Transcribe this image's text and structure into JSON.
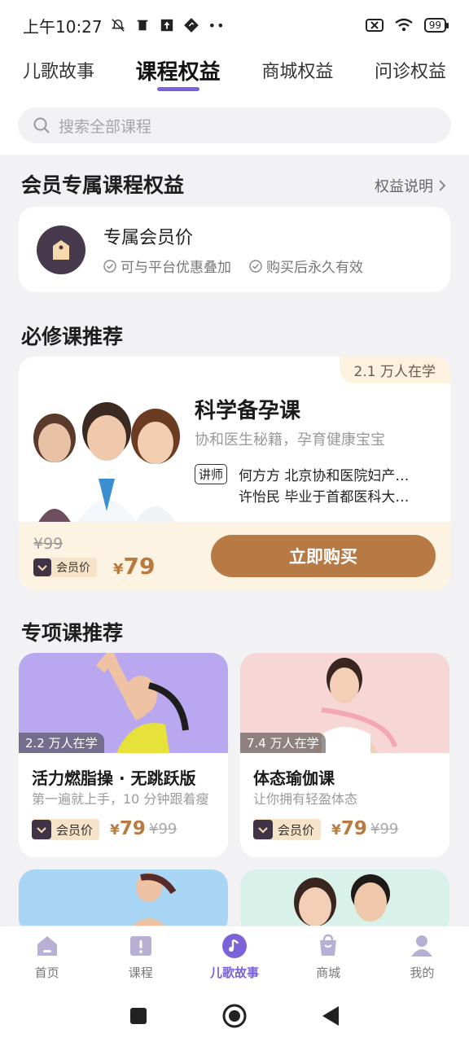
{
  "status_bar": {
    "time": "上午10:27",
    "battery": "99"
  },
  "top_tabs": [
    {
      "label": "儿歌故事",
      "active": false
    },
    {
      "label": "课程权益",
      "active": true
    },
    {
      "label": "商城权益",
      "active": false
    },
    {
      "label": "问诊权益",
      "active": false
    }
  ],
  "search": {
    "placeholder": "搜索全部课程"
  },
  "member_section": {
    "title": "会员专属课程权益",
    "link": "权益说明",
    "benefit_title": "专属会员价",
    "benefit_items": [
      "可与平台优惠叠加",
      "购买后永久有效"
    ]
  },
  "required_section": {
    "title": "必修课推荐",
    "course": {
      "learners": "2.1 万人在学",
      "title": "科学备孕课",
      "subtitle": "协和医生秘籍，孕育健康宝宝",
      "lecturer_badge": "讲师",
      "lecturers": [
        "何方方 北京协和医院妇产…",
        "许怡民 毕业于首都医科大…"
      ],
      "old_price": "¥99",
      "member_label": "会员价",
      "currency": "¥",
      "price": "79",
      "buy_label": "立即购买"
    }
  },
  "special_section": {
    "title": "专项课推荐",
    "courses": [
      {
        "learners": "2.2 万人在学",
        "title": "活力燃脂操 · 无跳跃版",
        "subtitle": "第一遍就上手，10 分钟跟着瘦",
        "member_label": "会员价",
        "currency": "¥",
        "price": "79",
        "old_price": "¥99"
      },
      {
        "learners": "7.4 万人在学",
        "title": "体态瑜伽课",
        "subtitle": "让你拥有轻盈体态",
        "member_label": "会员价",
        "currency": "¥",
        "price": "79",
        "old_price": "¥99"
      }
    ]
  },
  "bottom_nav": [
    {
      "label": "首页",
      "icon": "home-icon",
      "active": false
    },
    {
      "label": "课程",
      "icon": "course-icon",
      "active": false
    },
    {
      "label": "儿歌故事",
      "icon": "music-icon",
      "active": true
    },
    {
      "label": "商城",
      "icon": "shop-icon",
      "active": false
    },
    {
      "label": "我的",
      "icon": "profile-icon",
      "active": false
    }
  ],
  "colors": {
    "accent": "#7a63d8",
    "price": "#b87a3e",
    "buy_button": "#b77a45",
    "member_badge": "#463a4c"
  }
}
